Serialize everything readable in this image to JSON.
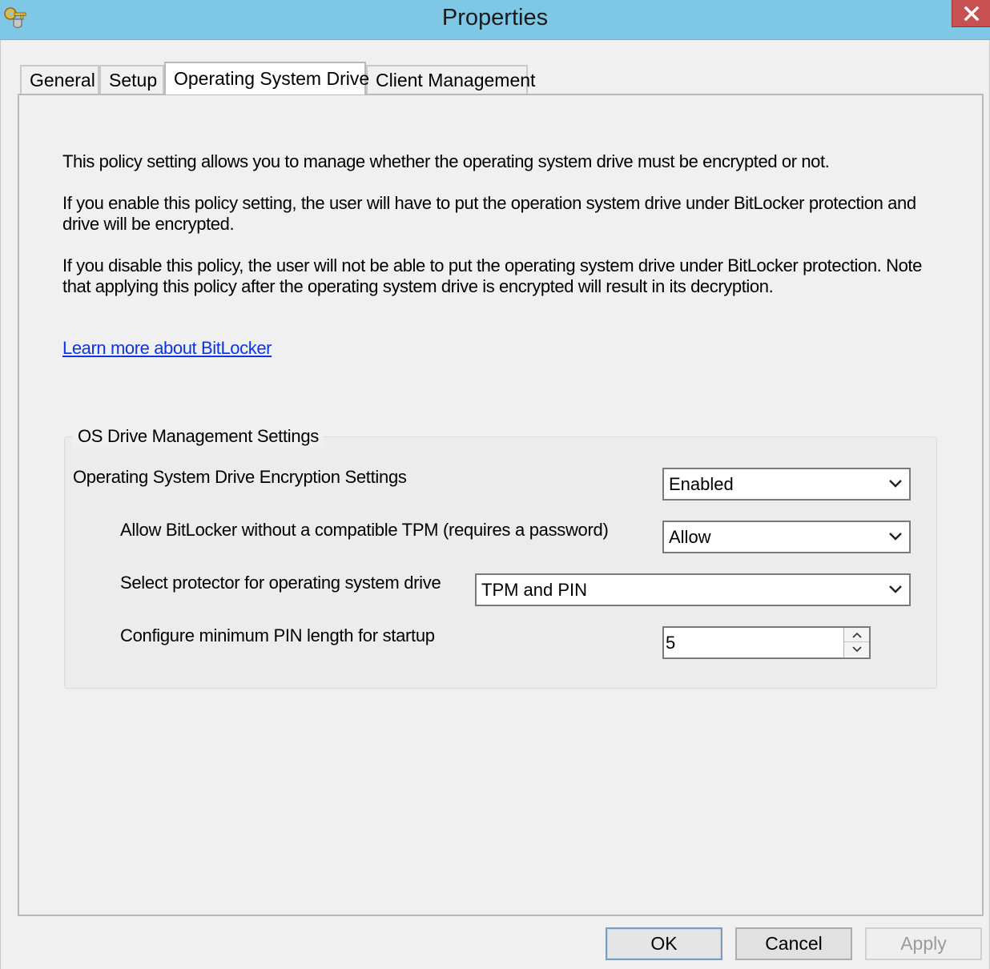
{
  "window": {
    "title": "Properties",
    "close_icon": "close-icon",
    "app_icon": "key-shield-icon"
  },
  "tabs": [
    {
      "label": "General",
      "active": false
    },
    {
      "label": "Setup",
      "active": false
    },
    {
      "label": "Operating System Drive",
      "active": true
    },
    {
      "label": "Client Management",
      "active": false
    }
  ],
  "page": {
    "description": [
      "This policy setting allows you to manage whether the operating system drive must be encrypted or not.",
      "If you enable this policy setting, the user will have to put the operation system drive under BitLocker protection and drive will be encrypted.",
      "If you disable this policy, the user will not be able to put the operating system drive under BitLocker protection. Note that applying this policy after the operating system drive is encrypted will result in its decryption."
    ],
    "learn_more_link": "Learn more about BitLocker"
  },
  "group": {
    "title": "OS Drive Management Settings",
    "settings": [
      {
        "label": "Operating System Drive Encryption Settings",
        "value": "Enabled"
      },
      {
        "label": "Allow BitLocker without a compatible TPM (requires a password)",
        "value": "Allow"
      },
      {
        "label": "Select protector for operating system drive",
        "value": "TPM and PIN"
      },
      {
        "label": "Configure minimum PIN length for startup",
        "value": "5"
      }
    ]
  },
  "buttons": {
    "ok": "OK",
    "cancel": "Cancel",
    "apply": "Apply"
  }
}
